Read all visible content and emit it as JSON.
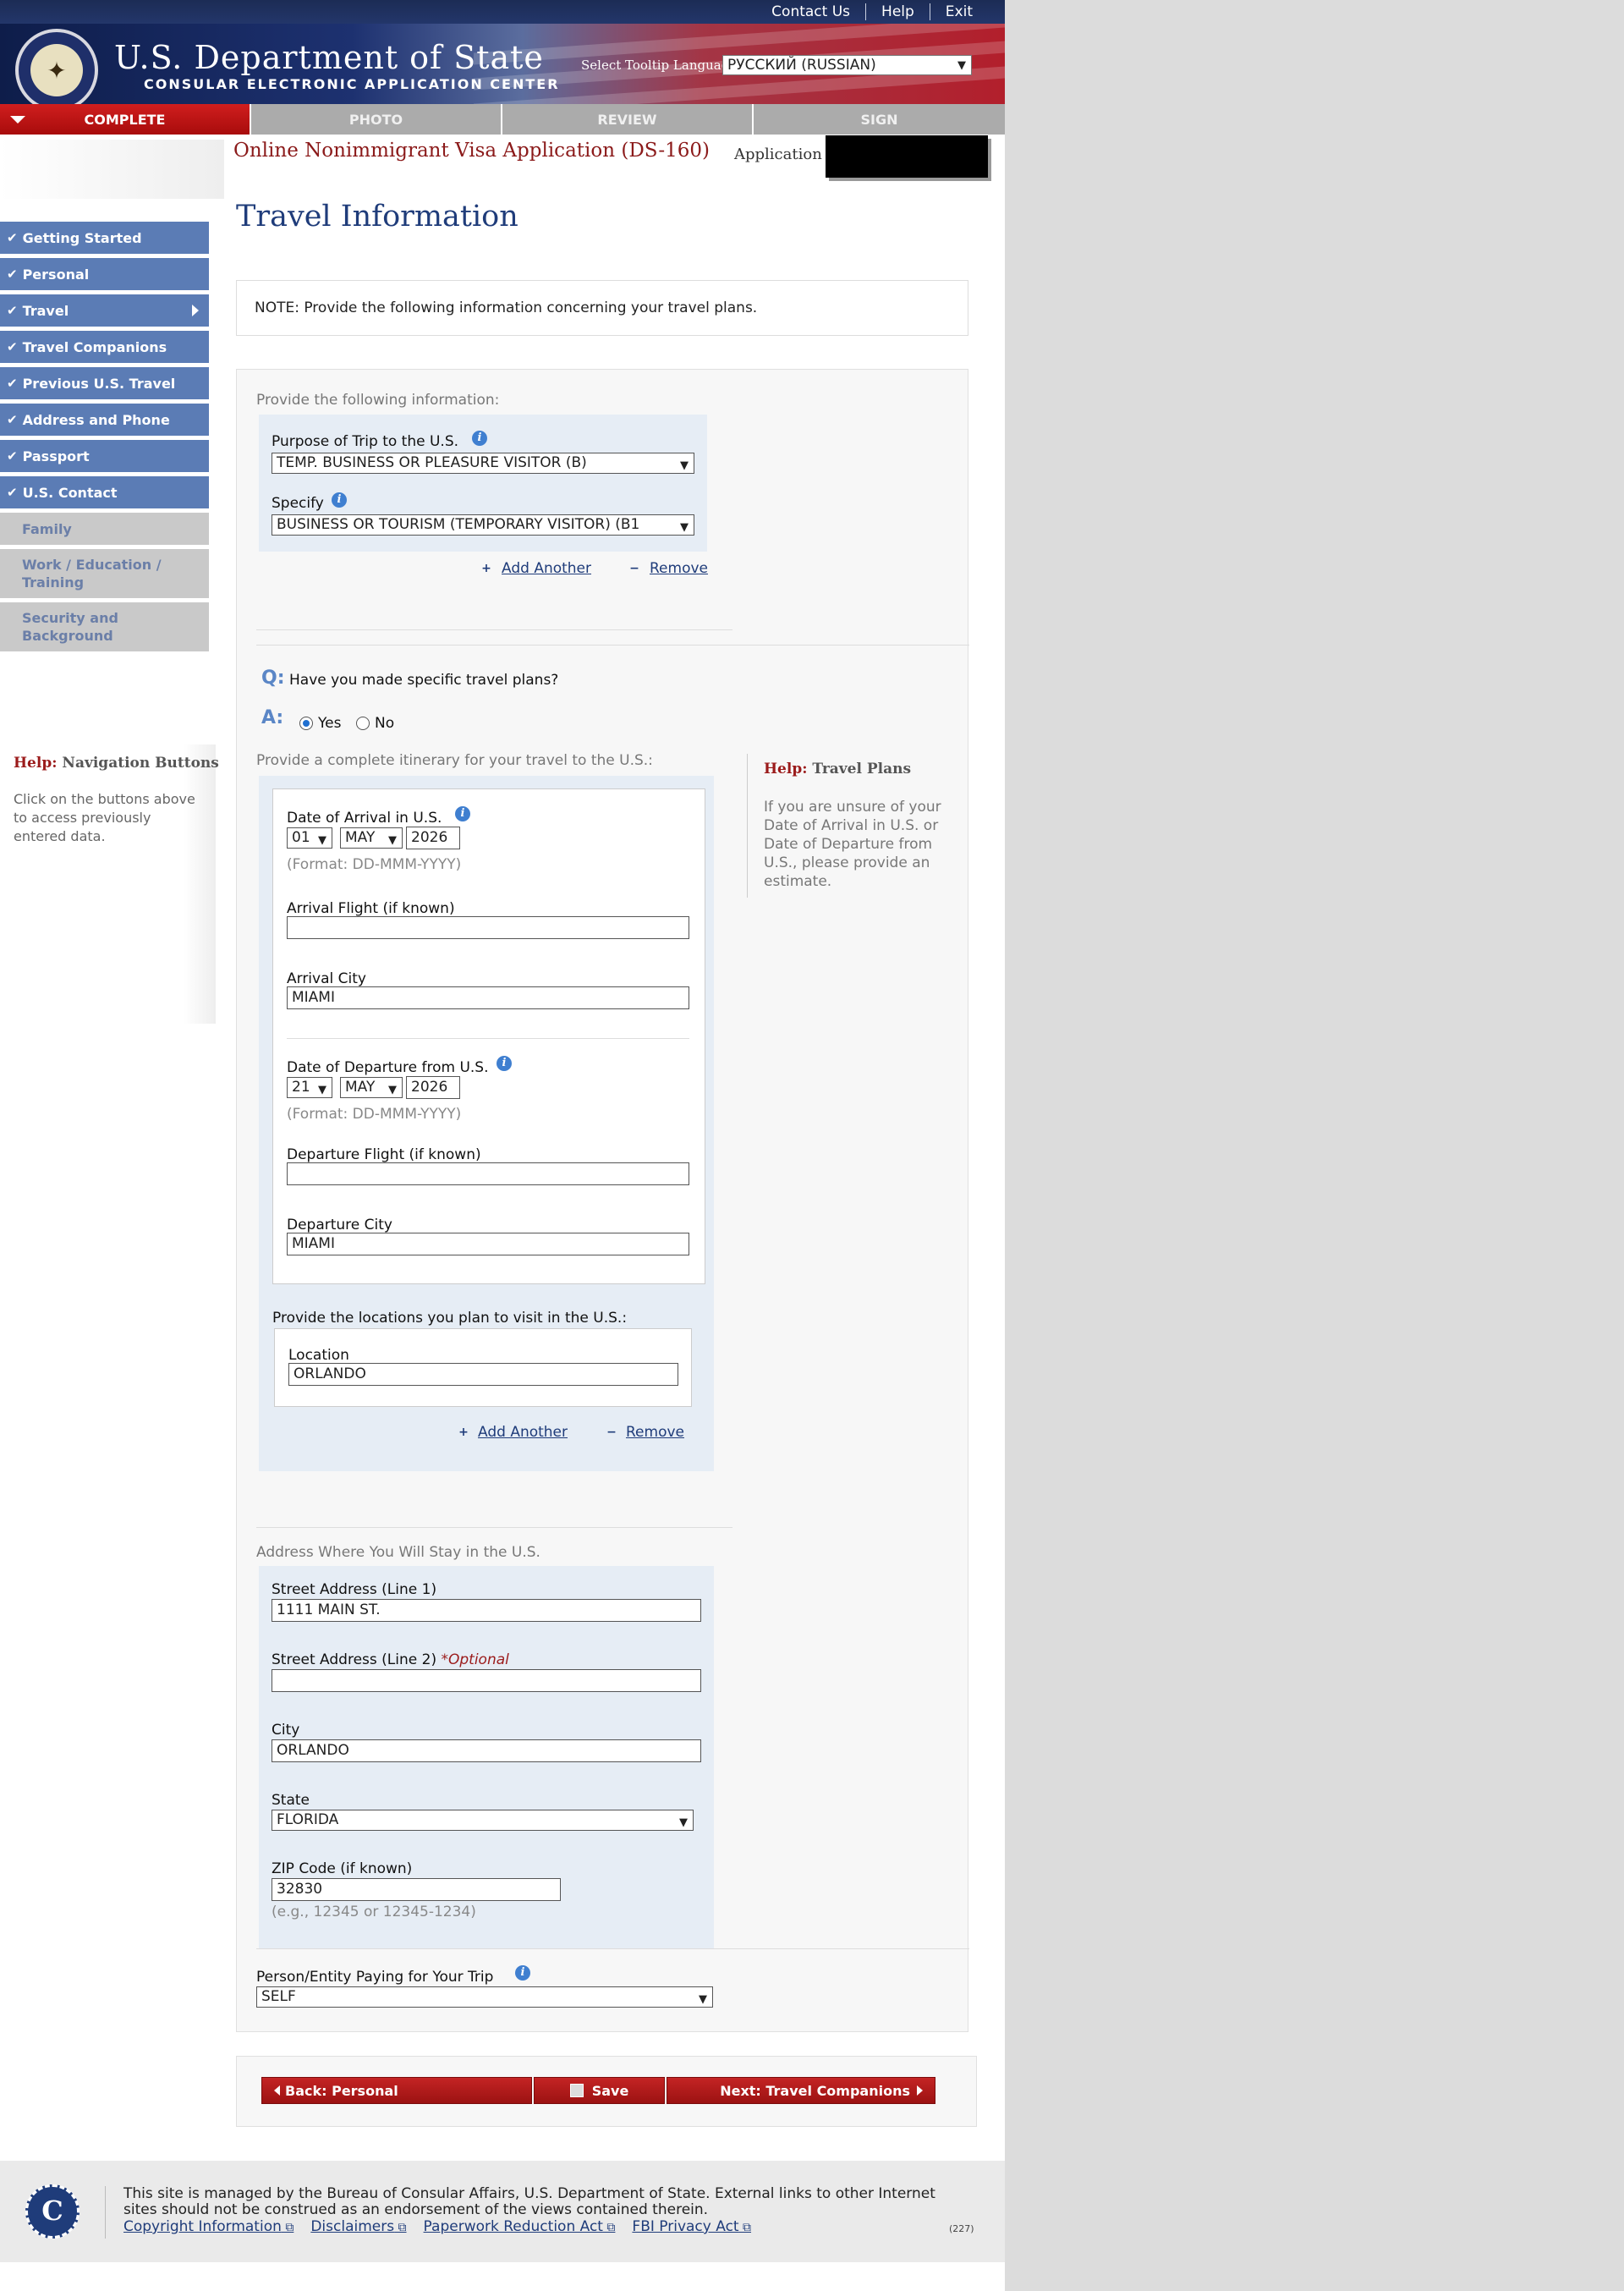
{
  "header": {
    "top_links": [
      "Contact Us",
      "Help",
      "Exit"
    ],
    "dept_title": "U.S. Department of State",
    "ceac_title": "CONSULAR ELECTRONIC APPLICATION CENTER",
    "language_label": "Select Tooltip Language",
    "language_value": "РУССКИЙ (RUSSIAN)"
  },
  "tabs": [
    "COMPLETE",
    "PHOTO",
    "REVIEW",
    "SIGN"
  ],
  "form_title": "Online Nonimmigrant Visa Application (DS-160)",
  "application_label": "Application",
  "sidebar": {
    "items": [
      {
        "label": "Getting Started",
        "done": true
      },
      {
        "label": "Personal",
        "done": true
      },
      {
        "label": "Travel",
        "done": true
      },
      {
        "label": "Travel Companions",
        "done": true
      },
      {
        "label": "Previous U.S. Travel",
        "done": true
      },
      {
        "label": "Address and Phone",
        "done": true
      },
      {
        "label": "Passport",
        "done": true
      },
      {
        "label": "U.S. Contact",
        "done": true
      },
      {
        "label": "Family",
        "done": false
      },
      {
        "label": "Work / Education / Training",
        "done": false
      },
      {
        "label": "Security and Background",
        "done": false
      }
    ],
    "help_prefix": "Help:",
    "help_title": "Navigation Buttons",
    "help_text": "Click on the buttons above to access previously entered data."
  },
  "page_title": "Travel Information",
  "note": "NOTE: Provide the following information concerning your travel plans.",
  "purpose": {
    "heading": "Provide the following information:",
    "purpose_label": "Purpose of Trip to the U.S.",
    "purpose_value": "TEMP. BUSINESS OR PLEASURE VISITOR (B)",
    "specify_label": "Specify",
    "specify_value": "BUSINESS OR TOURISM (TEMPORARY VISITOR) (B1",
    "add_another": "Add Another",
    "remove": "Remove"
  },
  "plans": {
    "q_mark": "Q:",
    "question": "Have you made specific travel plans?",
    "a_mark": "A:",
    "yes": "Yes",
    "no": "No",
    "selected": "Yes"
  },
  "itinerary": {
    "heading": "Provide a complete itinerary for your travel to the U.S.:",
    "arrival_date_label": "Date of Arrival in U.S.",
    "arrival_day": "01",
    "arrival_month": "MAY",
    "arrival_year": "2026",
    "date_format": "(Format: DD-MMM-YYYY)",
    "arrival_flight_label": "Arrival Flight (if known)",
    "arrival_flight_value": "",
    "arrival_city_label": "Arrival City",
    "arrival_city_value": "MIAMI",
    "departure_date_label": "Date of Departure from U.S.",
    "departure_day": "21",
    "departure_month": "MAY",
    "departure_year": "2026",
    "departure_flight_label": "Departure Flight (if known)",
    "departure_flight_value": "",
    "departure_city_label": "Departure City",
    "departure_city_value": "MIAMI",
    "locations_heading": "Provide the locations you plan to visit in the U.S.:",
    "location_label": "Location",
    "location_value": "ORLANDO",
    "add_another": "Add Another",
    "remove": "Remove"
  },
  "help_travel": {
    "prefix": "Help:",
    "title": "Travel Plans",
    "text": "If you are unsure of your Date of Arrival in U.S. or Date of Departure from U.S., please provide an estimate."
  },
  "address": {
    "heading": "Address Where You Will Stay in the U.S.",
    "street1_label": "Street Address (Line 1)",
    "street1_value": "1111 MAIN ST.",
    "street2_label": "Street Address (Line 2)",
    "optional": "*Optional",
    "street2_value": "",
    "city_label": "City",
    "city_value": "ORLANDO",
    "state_label": "State",
    "state_value": "FLORIDA",
    "zip_label": "ZIP Code (if known)",
    "zip_value": "32830",
    "zip_hint": "(e.g., 12345 or 12345-1234)"
  },
  "payer": {
    "label": "Person/Entity Paying for Your Trip",
    "value": "SELF"
  },
  "buttons": {
    "back": "Back: Personal",
    "save": "Save",
    "next": "Next: Travel Companions"
  },
  "footer": {
    "logo_letter": "C",
    "text": "This site is managed by the Bureau of Consular Affairs, U.S. Department of State. External links to other Internet sites should not be construed as an endorsement of the views contained therein.",
    "links": [
      "Copyright Information",
      "Disclaimers",
      "Paperwork Reduction Act",
      "FBI Privacy Act"
    ],
    "code": "(227)"
  },
  "colors": {
    "brand_red": "#a80c0c",
    "nav_blue": "#5b7cb5",
    "title_blue": "#1f3c7a",
    "panel_blue": "#e6edf5"
  }
}
